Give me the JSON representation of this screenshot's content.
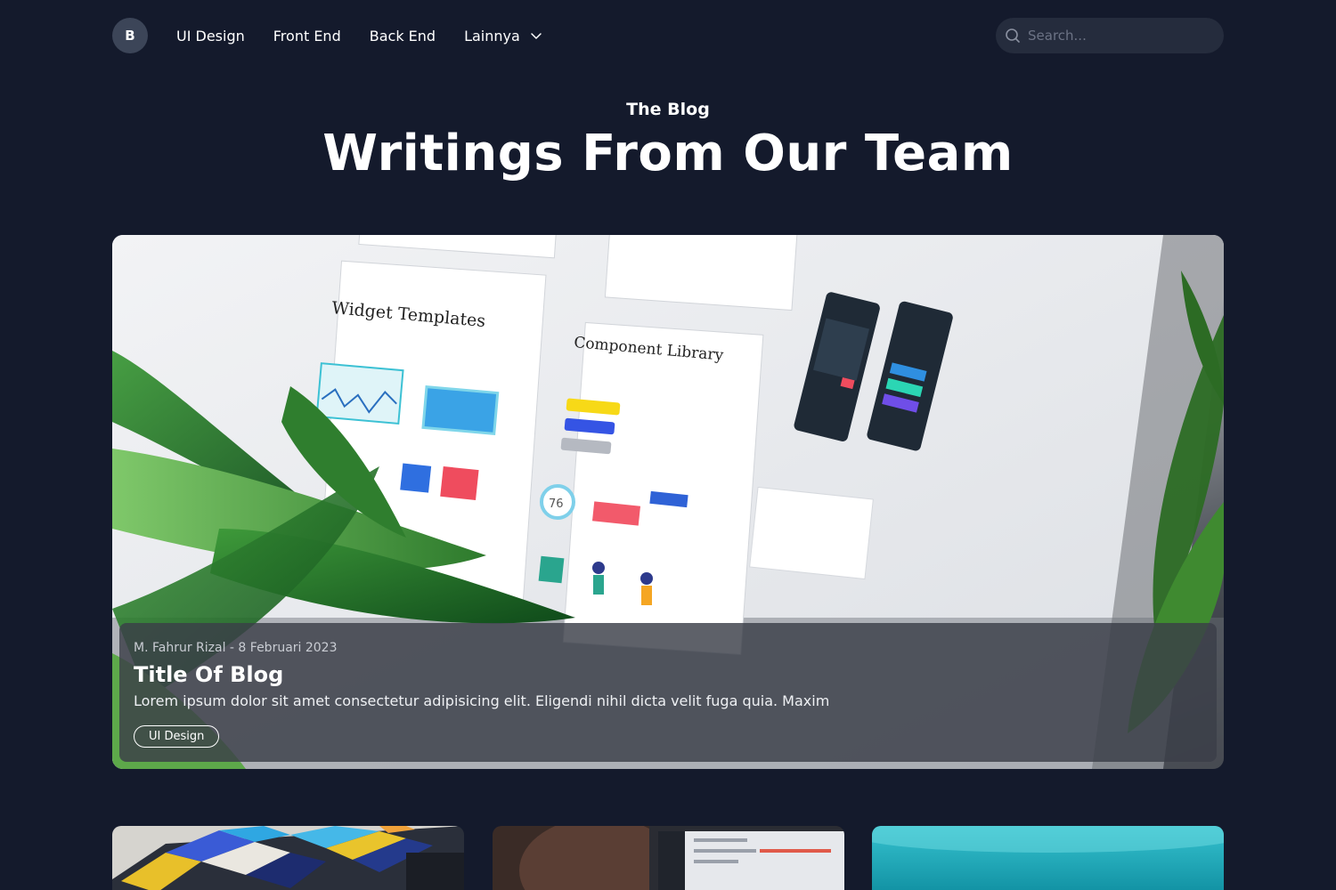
{
  "nav": {
    "logo_letter": "B",
    "links": [
      "UI Design",
      "Front End",
      "Back End"
    ],
    "more_label": "Lainnya",
    "search_placeholder": "Search..."
  },
  "hero": {
    "eyebrow": "The Blog",
    "title": "Writings From Our Team"
  },
  "featured": {
    "meta": "M. Fahrur Rizal - 8 Februari 2023",
    "title": "Title Of Blog",
    "excerpt": "Lorem ipsum dolor sit amet consectetur adipisicing elit. Eligendi nihil dicta velit fuga quia. Maxim",
    "tag": "UI Design",
    "image_texts": {
      "widget": "Widget Templates",
      "component": "Component Library",
      "gauge": "76"
    }
  },
  "colors": {
    "background": "#141a2c",
    "search_bg": "#252c3d",
    "logo_bg": "#3c4558",
    "overlay": "#3a3e48"
  }
}
